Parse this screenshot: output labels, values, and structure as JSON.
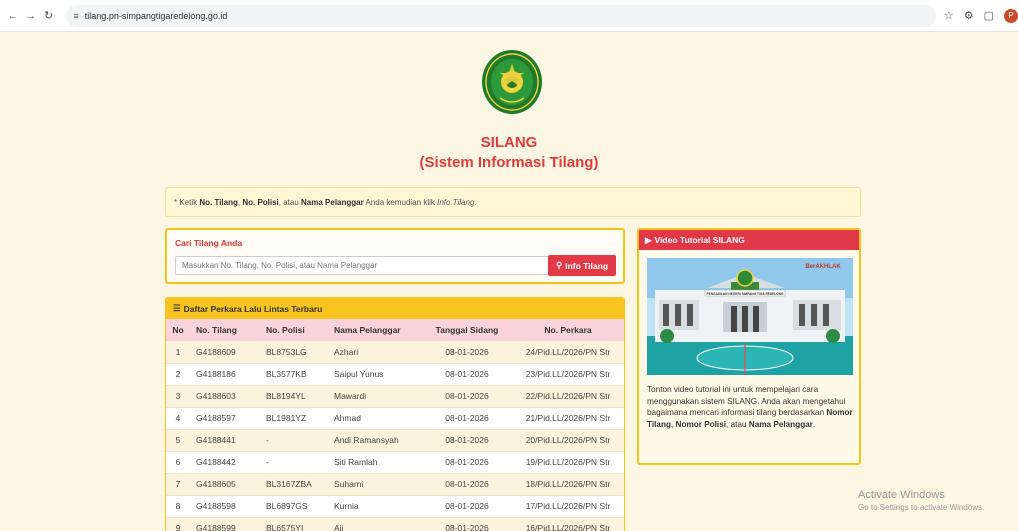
{
  "browser": {
    "url": "tilang.pn-simpangtigaredelong.go.id",
    "profile_initial": "P"
  },
  "header": {
    "title": "SILANG",
    "subtitle": "(Sistem Informasi Tilang)"
  },
  "notice": {
    "prefix": "* Ketik ",
    "k1": "No. Tilang",
    "sep1": ", ",
    "k2": "No. Polisi",
    "sep2": ", atau ",
    "k3": "Nama Pelanggar",
    "mid": " Anda kemudian klik ",
    "k4": "Info Tilang",
    "suffix": "."
  },
  "search": {
    "title": "Cari Tilang Anda",
    "placeholder": "Masukkan No. Tilang, No. Polisi, atau Nama Pelanggar",
    "button": "Info Tilang"
  },
  "table": {
    "title": "Daftar Perkara Lalu Lintas Terbaru",
    "columns": [
      "No",
      "No. Tilang",
      "No. Polisi",
      "Nama Pelanggar",
      "Tanggal Sidang",
      "No. Perkara"
    ],
    "rows": [
      [
        "1",
        "G4188609",
        "BL8753LG",
        "Azhari",
        "08-01-2026",
        "24/Pid.LL/2026/PN Str"
      ],
      [
        "2",
        "G4188186",
        "BL3577KB",
        "Saipul Yunus",
        "08-01-2026",
        "23/Pid.LL/2026/PN Str"
      ],
      [
        "3",
        "G4188603",
        "BL8194YL",
        "Mawardi",
        "08-01-2026",
        "22/Pid.LL/2026/PN Str"
      ],
      [
        "4",
        "G4188597",
        "BL1981YZ",
        "Ahmad",
        "08-01-2026",
        "21/Pid.LL/2026/PN Str"
      ],
      [
        "5",
        "G4188441",
        "-",
        "Andi Ramansyah",
        "08-01-2026",
        "20/Pid.LL/2026/PN Str"
      ],
      [
        "6",
        "G4188442",
        "-",
        "Siti Ramlah",
        "08-01-2026",
        "19/Pid.LL/2026/PN Str"
      ],
      [
        "7",
        "G4188605",
        "BL3167ZBA",
        "Suharni",
        "08-01-2026",
        "18/Pid.LL/2026/PN Str"
      ],
      [
        "8",
        "G4188598",
        "BL6897GS",
        "Kurnia",
        "08-01-2026",
        "17/Pid.LL/2026/PN Str"
      ],
      [
        "9",
        "G4188599",
        "BL6575YI",
        "Aji",
        "08-01-2026",
        "16/Pid.LL/2026/PN Str"
      ]
    ]
  },
  "video": {
    "title": "Video Tutorial SILANG",
    "sign_text": "PENGADILAN NEGERI SIMPANG TIGA REDELONG",
    "badge": "BerAKHLAK",
    "desc_prefix": "Tonton video tutorial ini untuk mempelajari cara menggunakan sistem SILANG. Anda akan mengetahui bagaimana mencari informasi tilang berdasarkan ",
    "k1": "Nomor Tilang",
    "sep1": ", ",
    "k2": "Nomor Polisi",
    "sep2": ", atau ",
    "k3": "Nama Pelanggar",
    "suffix": "."
  },
  "watermark": {
    "line1": "Activate Windows",
    "line2": "Go to Settings to activate Windows."
  },
  "colors": {
    "accent_red": "#e03b3b",
    "accent_yellow": "#f8c41f",
    "page_bg": "#fdf6e3"
  }
}
